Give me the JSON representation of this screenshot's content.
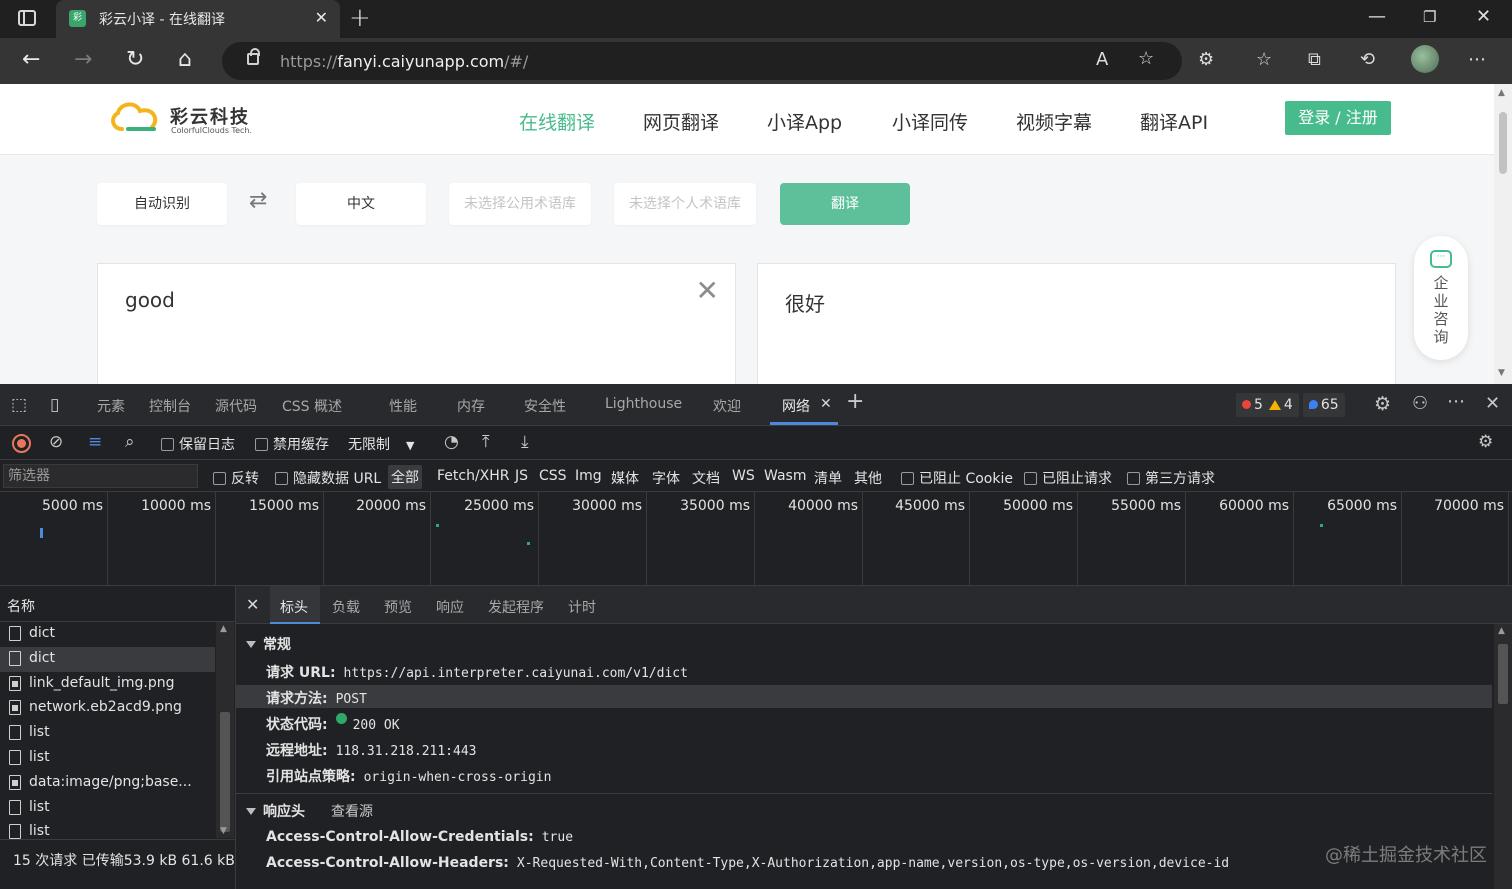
{
  "browser": {
    "tab_title": "彩云小译 - 在线翻译",
    "tab_favicon": "彩",
    "url_prefix": "https://",
    "url_host": "fanyi.caiyunapp.com",
    "url_path": "/#/"
  },
  "site": {
    "logo_text": "彩云科技",
    "logo_sub": "ColorfulClouds Tech.",
    "nav": [
      "在线翻译",
      "网页翻译",
      "小译App",
      "小译同传",
      "视频字幕",
      "翻译API"
    ],
    "login": "登录 / 注册",
    "source_lang": "自动识别",
    "target_lang": "中文",
    "public_glossary": "未选择公用术语库",
    "personal_glossary": "未选择个人术语库",
    "translate": "翻译",
    "input_text": "good",
    "output_text": "很好",
    "consult": "企业咨询",
    "accent": "#48bb8c"
  },
  "devtools": {
    "tabs": [
      "元素",
      "控制台",
      "源代码",
      "CSS 概述",
      "性能",
      "内存",
      "安全性",
      "Lighthouse",
      "欢迎",
      "网络"
    ],
    "errors": "5",
    "warnings": "4",
    "messages": "65",
    "toolbar": {
      "preserve_log": "保留日志",
      "disable_cache": "禁用缓存",
      "throttle": "无限制"
    },
    "filter": {
      "placeholder": "筛选器",
      "invert": "反转",
      "hide_data_url": "隐藏数据 URL",
      "types": [
        "全部",
        "Fetch/XHR",
        "JS",
        "CSS",
        "Img",
        "媒体",
        "字体",
        "文档",
        "WS",
        "Wasm",
        "清单",
        "其他"
      ],
      "blocked_cookies": "已阻止 Cookie",
      "blocked_requests": "已阻止请求",
      "third_party": "第三方请求"
    },
    "timeline_labels": [
      "5000 ms",
      "10000 ms",
      "15000 ms",
      "20000 ms",
      "25000 ms",
      "30000 ms",
      "35000 ms",
      "40000 ms",
      "45000 ms",
      "50000 ms",
      "55000 ms",
      "60000 ms",
      "65000 ms",
      "70000 ms"
    ],
    "names_header": "名称",
    "requests": [
      {
        "name": "dict",
        "kind": "doc"
      },
      {
        "name": "dict",
        "kind": "doc"
      },
      {
        "name": "link_default_img.png",
        "kind": "img"
      },
      {
        "name": "network.eb2acd9.png",
        "kind": "img"
      },
      {
        "name": "list",
        "kind": "doc"
      },
      {
        "name": "list",
        "kind": "doc"
      },
      {
        "name": "data:image/png;base...",
        "kind": "img"
      },
      {
        "name": "list",
        "kind": "doc"
      },
      {
        "name": "list",
        "kind": "doc"
      }
    ],
    "summary": "15 次请求  已传输53.9 kB  61.6 kB 条",
    "detail_tabs": [
      "标头",
      "负载",
      "预览",
      "响应",
      "发起程序",
      "计时"
    ],
    "general_title": "常规",
    "general": [
      {
        "k": "请求 URL:",
        "v": "https://api.interpreter.caiyunai.com/v1/dict"
      },
      {
        "k": "请求方法:",
        "v": "POST"
      },
      {
        "k": "状态代码:",
        "v": "200 OK"
      },
      {
        "k": "远程地址:",
        "v": "118.31.218.211:443"
      },
      {
        "k": "引用站点策略:",
        "v": "origin-when-cross-origin"
      }
    ],
    "response_title": "响应头",
    "view_source": "查看源",
    "response_headers": [
      {
        "k": "Access-Control-Allow-Credentials:",
        "v": "true"
      },
      {
        "k": "Access-Control-Allow-Headers:",
        "v": "X-Requested-With,Content-Type,X-Authorization,app-name,version,os-type,os-version,device-id"
      }
    ]
  },
  "watermark": "@稀土掘金技术社区"
}
